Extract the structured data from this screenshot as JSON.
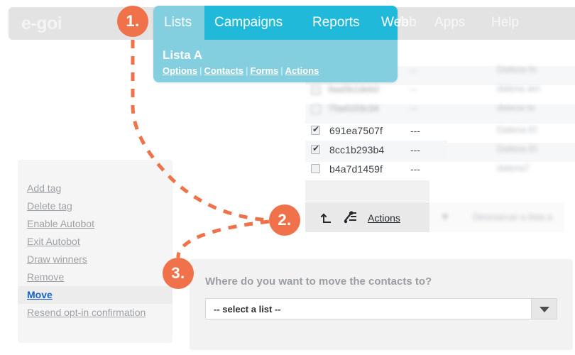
{
  "app": {
    "logo": "e-goi"
  },
  "topbar": {
    "faded_items": [
      {
        "label": "Web"
      },
      {
        "label": "Apps"
      },
      {
        "label": "Help"
      }
    ]
  },
  "nav": {
    "items": [
      {
        "label": "Lists",
        "active": true
      },
      {
        "label": "Campaigns",
        "active": false
      },
      {
        "label": "Reports",
        "active": false
      },
      {
        "label": "Web",
        "active": false
      }
    ],
    "list_title": "Lista A",
    "sublinks": [
      {
        "label": "Options"
      },
      {
        "label": "Contacts"
      },
      {
        "label": "Forms"
      },
      {
        "label": "Actions"
      }
    ],
    "separator": "|"
  },
  "contacts": {
    "rows": [
      {
        "id": "691ea7507f",
        "value": "---",
        "checked": true
      },
      {
        "id": "8cc1b293b4",
        "value": "---",
        "checked": true
      },
      {
        "id": "b4a7d1459f",
        "value": "---",
        "checked": false
      }
    ]
  },
  "toolbar": {
    "export_icon": "export-up-arrow-icon",
    "tools_icon": "tools-settings-icon",
    "actions_label": "Actions"
  },
  "actions_menu": {
    "items": [
      {
        "label": "Add tag",
        "active": false
      },
      {
        "label": "Delete tag",
        "active": false
      },
      {
        "label": "Enable Autobot",
        "active": false
      },
      {
        "label": "Exit Autobot",
        "active": false
      },
      {
        "label": "Draw winners",
        "active": false
      },
      {
        "label": "Remove",
        "active": false
      },
      {
        "label": "Move",
        "active": true
      },
      {
        "label": "Resend opt-in confirmation",
        "active": false
      }
    ]
  },
  "move_panel": {
    "question": "Where do you want to move the contacts to?",
    "select_value": "-- select a list --",
    "dropdown_icon": "chevron-down-icon"
  },
  "steps": [
    {
      "label": "1."
    },
    {
      "label": "2."
    },
    {
      "label": "3."
    }
  ],
  "colors": {
    "accent_orange": "#f0724a",
    "nav_cyan": "#20b9da",
    "nav_light_cyan": "#83cfe0",
    "link_blue": "#1862c6"
  }
}
